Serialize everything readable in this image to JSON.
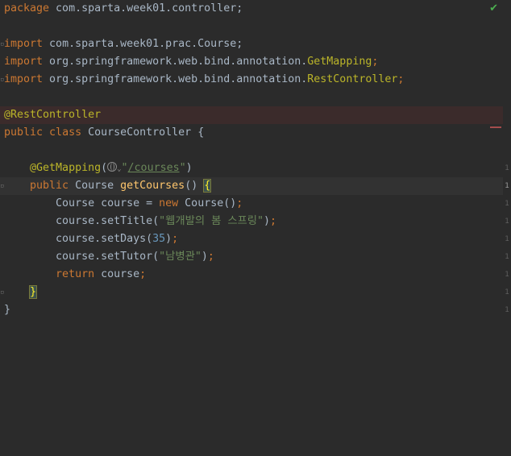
{
  "editor": {
    "file_status_icon": "checkmark-icon",
    "lines": {
      "l1_pkg_kw": "package",
      "l1_pkg_name": " com.sparta.week01.controller;",
      "l3_kw": "import",
      "l3_name": " com.sparta.week01.prac.Course;",
      "l4_kw": "import",
      "l4_name": " org.springframework.web.bind.annotation.",
      "l4_cls": "GetMapping",
      "l4_end": ";",
      "l5_kw": "import",
      "l5_name": " org.springframework.web.bind.annotation.",
      "l5_cls": "RestController",
      "l5_end": ";",
      "l7_ann": "@RestController",
      "l8_kw1": "public",
      "l8_kw2": " class",
      "l8_rest": " CourseController {",
      "l10_ann": "@GetMapping",
      "l10_paren": "(",
      "l10_q1": "\"",
      "l10_url": "/courses",
      "l10_q2": "\"",
      "l10_close": ")",
      "l11_kw": "public",
      "l11_type": " Course ",
      "l11_mth": "getCourses",
      "l11_parens": "() ",
      "l11_brace": "{",
      "l12_a": "Course course = ",
      "l12_kw": "new",
      "l12_b": " Course()",
      "l12_semi": ";",
      "l13_a": "course.setTitle(",
      "l13_str": "\"웹개발의 봄 스프링\"",
      "l13_b": ")",
      "l13_semi": ";",
      "l14_a": "course.setDays(",
      "l14_num": "35",
      "l14_b": ")",
      "l14_semi": ";",
      "l15_a": "course.setTutor(",
      "l15_str": "\"남병관\"",
      "l15_b": ")",
      "l15_semi": ";",
      "l16_kw": "return",
      "l16_a": " course",
      "l16_semi": ";",
      "l17_brace": "}",
      "l18_brace": "}"
    }
  }
}
